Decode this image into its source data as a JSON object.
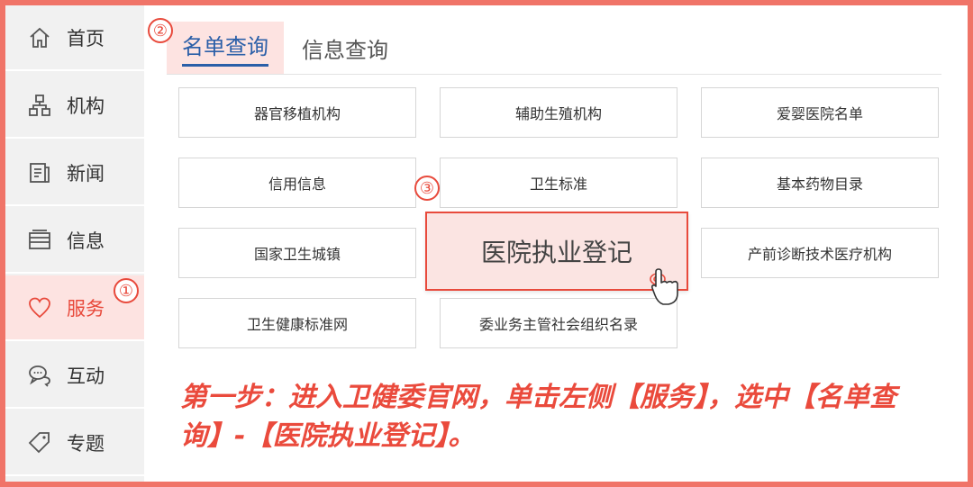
{
  "sidebar": {
    "items": [
      {
        "label": "首页",
        "icon": "home-icon"
      },
      {
        "label": "机构",
        "icon": "org-icon"
      },
      {
        "label": "新闻",
        "icon": "news-icon"
      },
      {
        "label": "信息",
        "icon": "info-icon"
      },
      {
        "label": "服务",
        "icon": "heart-icon",
        "active": true
      },
      {
        "label": "互动",
        "icon": "chat-icon"
      },
      {
        "label": "专题",
        "icon": "tag-icon"
      }
    ]
  },
  "steps": [
    "①",
    "②",
    "③"
  ],
  "tabs": [
    {
      "label": "名单查询",
      "active": true
    },
    {
      "label": "信息查询",
      "active": false
    }
  ],
  "grid": [
    "器官移植机构",
    "辅助生殖机构",
    "爱婴医院名单",
    "信用信息",
    "卫生标准",
    "基本药物目录",
    "国家卫生城镇",
    "医院执业登记",
    "产前诊断技术医疗机构",
    "卫生健康标准网",
    "委业务主管社会组织名录"
  ],
  "instruction": "第一步：进入卫健委官网，单击左侧【服务】，选中【名单查询】-【医院执业登记】。",
  "colors": {
    "accent": "#e84a3c",
    "tab_active": "#2b5fa8",
    "frame": "#f07468"
  }
}
